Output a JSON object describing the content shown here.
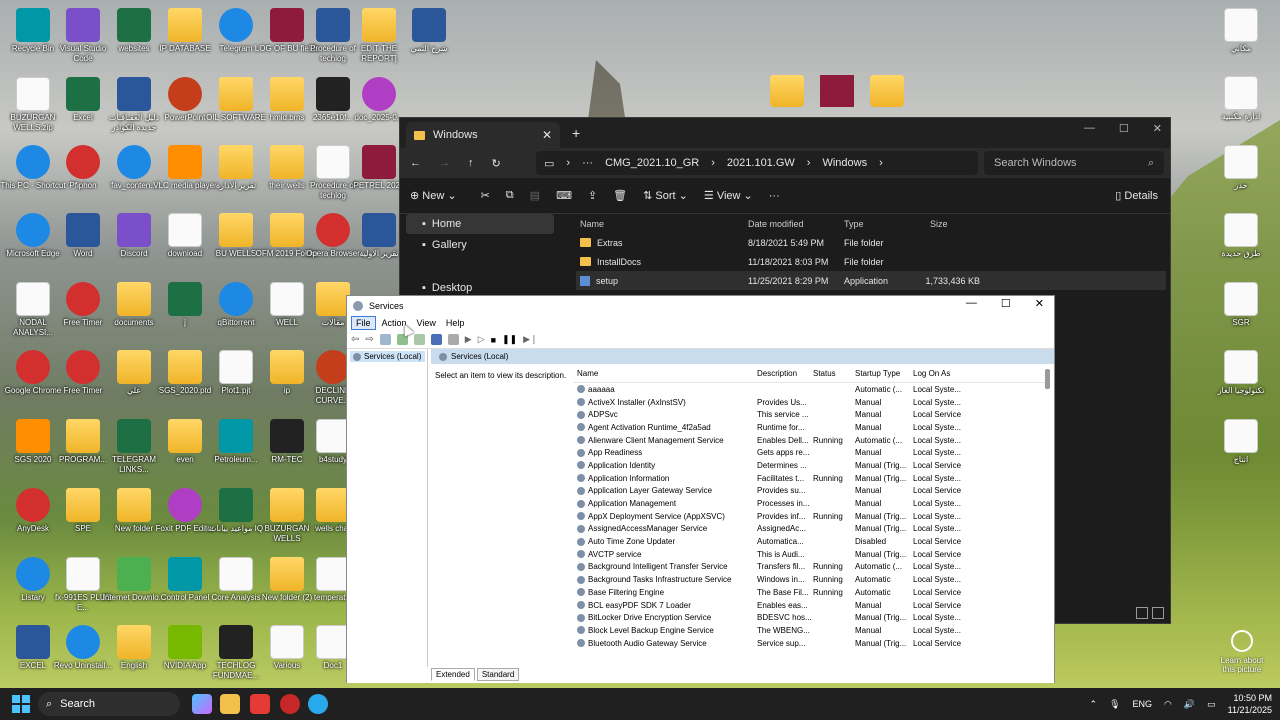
{
  "desktop": {
    "icons_col1": [
      "Recycle Bin",
      "BUZURGAN WELLS.zip",
      "This PC - Shortcut",
      "Microsoft Edge",
      "NODAL ANALYSI...",
      "Google Chrome",
      "SGS 2020",
      "AnyDesk",
      "Listary",
      "EXCEL"
    ],
    "icons_col2": [
      "Visual Studio Code",
      "Excel",
      "Pfiphon",
      "Word",
      "Free Timer",
      "Free Timer",
      "PROGRAM...",
      "SPE",
      "fx-991ES PLUS E...",
      "Revo Uninstall..."
    ],
    "icons_col3": [
      "websites",
      "دليل العقـاقـات جديدة الكوادر",
      "fav_conten...",
      "Discord",
      "documents",
      "علي",
      "TELEGRAM LINKS...",
      "New folder",
      "Internet Downlo...",
      "English"
    ],
    "icons_col4": [
      "IP DATABASE",
      "PowerPoint",
      "VLC media player",
      "download",
      "j",
      "SGS_2020.ptd",
      "even",
      "Foxit PDF Editor",
      "Control Panel",
      "NVIDIA App"
    ],
    "icons_col5": [
      "Telegram",
      "OIL SOFTWARE",
      "تقرير الادارة",
      "BU WELLS",
      "qBittorrent",
      "Plot1.pjt",
      "Petroleum...",
      "مواعيد بيانات IQ",
      "Core Analysis",
      "TECHLOG FUNDMAE..."
    ],
    "icons_col6": [
      "LOG OF BU fields",
      "hmid.bms",
      "their wells",
      "OFM 2019 Folder",
      "WELL",
      "ip",
      "RM-TEC",
      "BUZURGAN WELLS",
      "New folder (2)",
      "Various"
    ],
    "icons_col7": [
      "Procedure of techlog",
      "2365e10f...",
      "Procedure of techlog",
      "Opera Browser",
      "مقالات",
      "DECLINE CURVE...",
      "b4study",
      "wells char",
      "temperat...",
      "Doc1"
    ],
    "icons_col8": [
      "EDIT THE REPORT]",
      "doc_2025-0...",
      "PETREL 2021",
      "تقرير الاولية"
    ],
    "icons_col9": [
      "شرح الثمي"
    ],
    "icons_right": [
      "مكاني",
      "ادارة مكتبية",
      "حذر",
      "طرق حديدة",
      "SGR",
      "تكنولوجيا الغاز",
      "انتاج"
    ],
    "corner_widget": "Learn about this picture"
  },
  "taskbar": {
    "search_placeholder": "Search",
    "tray_lang": "ENG",
    "time": "10:50 PM",
    "date": "11/21/2025"
  },
  "explorer": {
    "tab_title": "Windows",
    "breadcrumb": [
      "CMG_2021.10_GR",
      "2021.101.GW",
      "Windows"
    ],
    "search_placeholder": "Search Windows",
    "toolbar": {
      "new": "New",
      "sort": "Sort",
      "view": "View",
      "details": "Details"
    },
    "sidebar": [
      {
        "label": "Home",
        "selected": true
      },
      {
        "label": "Gallery",
        "selected": false
      },
      {
        "label": "Desktop",
        "selected": false
      }
    ],
    "columns": [
      "Name",
      "Date modified",
      "Type",
      "Size"
    ],
    "files": [
      {
        "name": "Extras",
        "date": "8/18/2021 5:49 PM",
        "type": "File folder",
        "size": "",
        "kind": "folder"
      },
      {
        "name": "InstallDocs",
        "date": "11/18/2021 8:03 PM",
        "type": "File folder",
        "size": "",
        "kind": "folder"
      },
      {
        "name": "setup",
        "date": "11/25/2021 8:29 PM",
        "type": "Application",
        "size": "1,733,436 KB",
        "kind": "app"
      }
    ]
  },
  "services": {
    "title": "Services",
    "menu": [
      "File",
      "Action",
      "View",
      "Help"
    ],
    "tree_item": "Services (Local)",
    "banner": "Services (Local)",
    "description": "Select an item to view its description.",
    "columns": [
      "Name",
      "Description",
      "Status",
      "Startup Type",
      "Log On As"
    ],
    "rows": [
      [
        "aaaaaa",
        "",
        "",
        "Automatic (...",
        "Local Syste..."
      ],
      [
        "ActiveX Installer (AxInstSV)",
        "Provides Us...",
        "",
        "Manual",
        "Local Syste..."
      ],
      [
        "ADPSvc",
        "This service ...",
        "",
        "Manual",
        "Local Service"
      ],
      [
        "Agent Activation Runtime_4f2a5ad",
        "Runtime for...",
        "",
        "Manual",
        "Local Syste..."
      ],
      [
        "Alienware Client Management Service",
        "Enables Dell...",
        "Running",
        "Automatic (...",
        "Local Syste..."
      ],
      [
        "App Readiness",
        "Gets apps re...",
        "",
        "Manual",
        "Local Syste..."
      ],
      [
        "Application Identity",
        "Determines ...",
        "",
        "Manual (Trig...",
        "Local Service"
      ],
      [
        "Application Information",
        "Facilitates t...",
        "Running",
        "Manual (Trig...",
        "Local Syste..."
      ],
      [
        "Application Layer Gateway Service",
        "Provides su...",
        "",
        "Manual",
        "Local Service"
      ],
      [
        "Application Management",
        "Processes in...",
        "",
        "Manual",
        "Local Syste..."
      ],
      [
        "AppX Deployment Service (AppXSVC)",
        "Provides inf...",
        "Running",
        "Manual (Trig...",
        "Local Syste..."
      ],
      [
        "AssignedAccessManager Service",
        "AssignedAc...",
        "",
        "Manual (Trig...",
        "Local Syste..."
      ],
      [
        "Auto Time Zone Updater",
        "Automatica...",
        "",
        "Disabled",
        "Local Service"
      ],
      [
        "AVCTP service",
        "This is Audi...",
        "",
        "Manual (Trig...",
        "Local Service"
      ],
      [
        "Background Intelligent Transfer Service",
        "Transfers fil...",
        "Running",
        "Automatic (...",
        "Local Syste..."
      ],
      [
        "Background Tasks Infrastructure Service",
        "Windows in...",
        "Running",
        "Automatic",
        "Local Syste..."
      ],
      [
        "Base Filtering Engine",
        "The Base Fil...",
        "Running",
        "Automatic",
        "Local Service"
      ],
      [
        "BCL easyPDF SDK 7 Loader",
        "Enables eas...",
        "",
        "Manual",
        "Local Service"
      ],
      [
        "BitLocker Drive Encryption Service",
        "BDESVC hos...",
        "",
        "Manual (Trig...",
        "Local Syste..."
      ],
      [
        "Block Level Backup Engine Service",
        "The WBENG...",
        "",
        "Manual",
        "Local Syste..."
      ],
      [
        "Bluetooth Audio Gateway Service",
        "Service sup...",
        "",
        "Manual (Trig...",
        "Local Service"
      ]
    ],
    "tabs": [
      "Extended",
      "Standard"
    ]
  }
}
